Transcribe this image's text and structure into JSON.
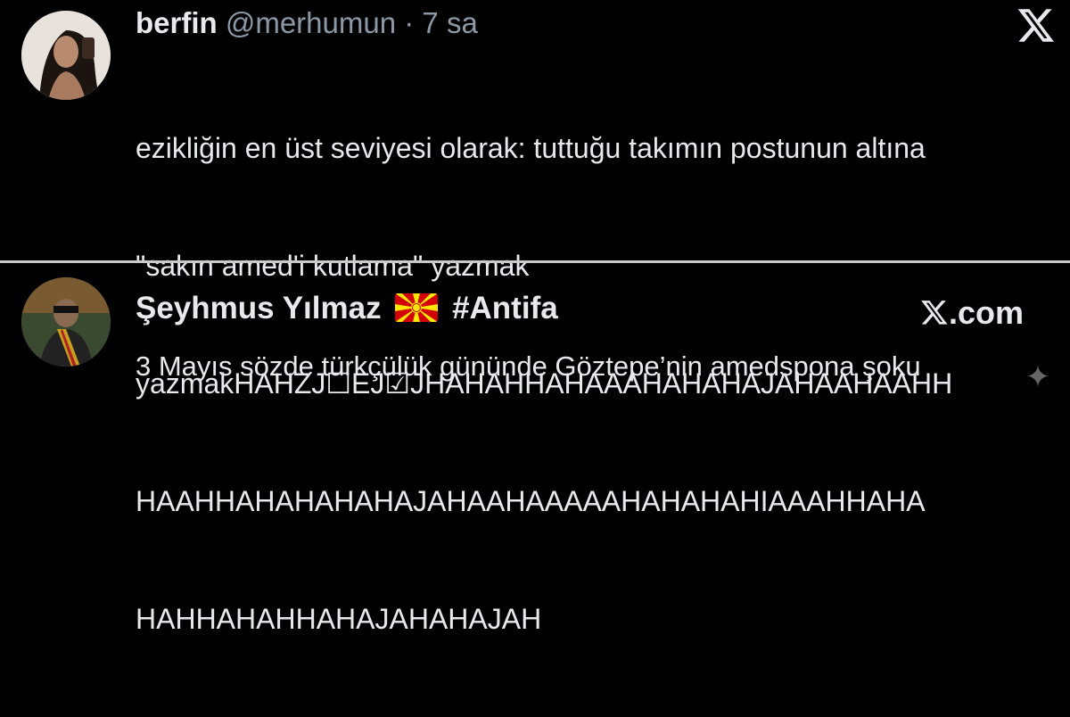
{
  "tweet1": {
    "name": "berfin",
    "handle": "@merhumun",
    "separator": "·",
    "time": "7 sa",
    "lines": [
      "ezikliğin en üst seviyesi olarak: tuttuğu takımın postunun altına",
      "\"sakın amed'i kutlama\" yazmak",
      "yazmakHAHZJ☐EJ☑JHAHAHHAHAAAHAHAHAJAHAAHAAHH",
      "HAAHHAHAHAHAHAJAHAAHAAAAAHAHAHAHIAAAHHAHA",
      "HAHHAHAHHAHAJAHAHAJAH"
    ],
    "logo_icon": "x-logo-icon"
  },
  "tweet2": {
    "name": "Şeyhmus Yılmaz",
    "flag_icon": "north-macedonia-flag-icon",
    "hashtag": "#Antifa",
    "source": ".com",
    "text": "3 Mayıs sözde türkçülük gününde Göztepe’nin amedspona şoku",
    "sparkle_icon": "sparkle-icon"
  },
  "colors": {
    "background": "#000000",
    "text": "#e7e9ea",
    "muted": "#8b98a5",
    "divider": "#c9c9c9"
  }
}
